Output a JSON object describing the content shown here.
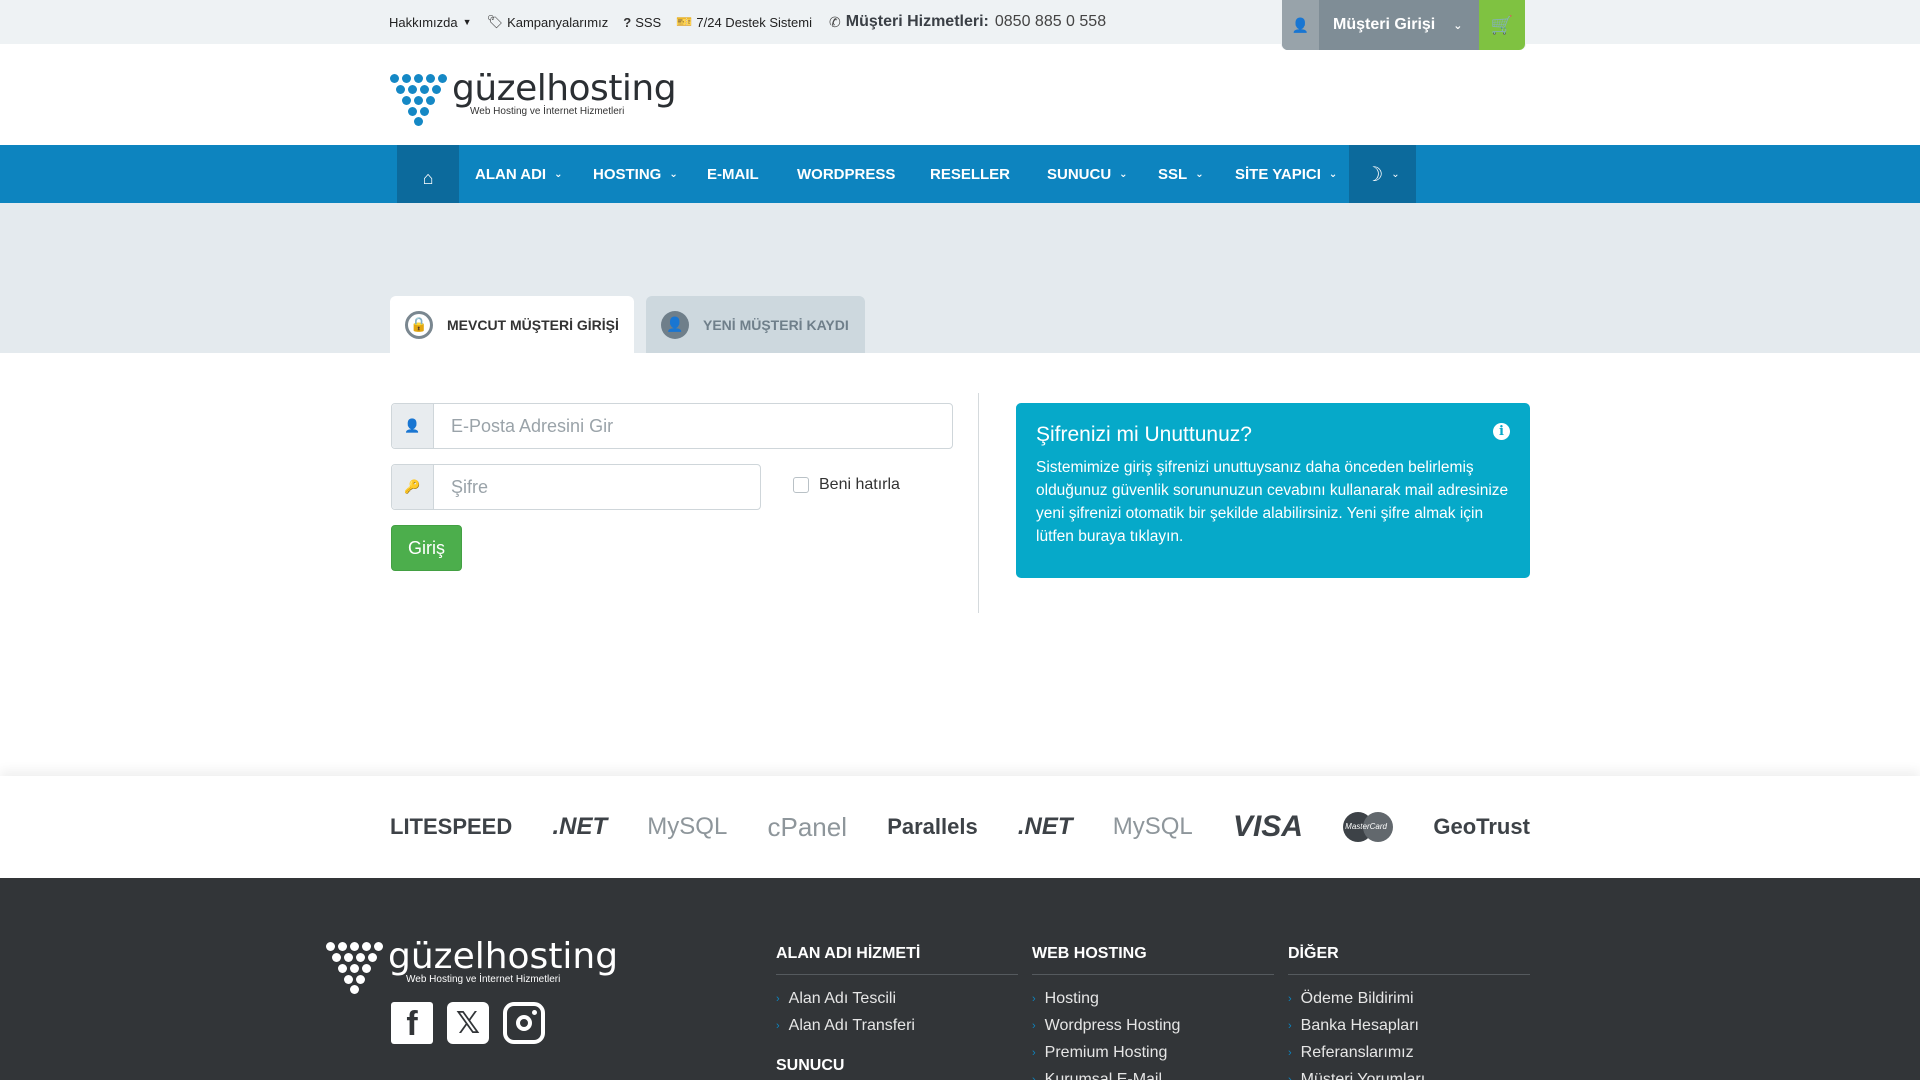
{
  "topbar": {
    "links": [
      {
        "label": "Hakkımızda",
        "icon": "none",
        "has_caret": true
      },
      {
        "label": "Kampanyalarımız",
        "icon": "tag-icon"
      },
      {
        "label": "SSS",
        "icon": "question-icon"
      },
      {
        "label": "7/24 Destek Sistemi",
        "icon": "ticket-icon"
      }
    ],
    "phone_label": "Müşteri Hizmetleri:",
    "phone_number": "0850 885 0 558",
    "login_label": "Müşteri Girişi"
  },
  "logo": {
    "name_part1": "güzel",
    "name_part2": "hosting",
    "tagline": "Web Hosting ve İnternet Hizmetleri"
  },
  "nav": {
    "items": [
      {
        "label": "ALAN ADI",
        "dropdown": true
      },
      {
        "label": "HOSTING",
        "dropdown": true
      },
      {
        "label": "E-MAIL",
        "dropdown": false
      },
      {
        "label": "WORDPRESS",
        "dropdown": false
      },
      {
        "label": "RESELLER",
        "dropdown": false
      },
      {
        "label": "SUNUCU",
        "dropdown": true
      },
      {
        "label": "SSL",
        "dropdown": true
      },
      {
        "label": "SİTE YAPICI",
        "dropdown": true
      }
    ]
  },
  "tabs": {
    "existing": "MEVCUT MÜŞTERİ GİRİŞİ",
    "new": "YENİ MÜŞTERİ KAYDI"
  },
  "form": {
    "email_placeholder": "E-Posta Adresini Gir",
    "password_placeholder": "Şifre",
    "remember_label": "Beni hatırla",
    "submit_label": "Giriş"
  },
  "info": {
    "title": "Şifrenizi mi Unuttunuz?",
    "text": "Sistemimize giriş şifrenizi unuttuysanız daha önceden belirlemiş olduğunuz güvenlik sorununuzun cevabını kullanarak mail adresinize yeni şifrenizi otomatik bir şekilde alabilirsiniz. Yeni şifre almak için lütfen buraya tıklayın."
  },
  "partners": [
    "LITESPEED",
    ".NET",
    "MySQL",
    "cPanel",
    "Parallels",
    ".NET",
    "MySQL",
    "VISA",
    "MasterCard",
    "GeoTrust"
  ],
  "footer": {
    "logo_name_part1": "güzel",
    "logo_name_part2": "hosting",
    "logo_tagline": "Web Hosting ve İnternet Hizmetleri",
    "col1": {
      "title": "ALAN ADI HİZMETİ",
      "items": [
        "Alan Adı Tescili",
        "Alan Adı Transferi"
      ],
      "title2": "SUNUCU"
    },
    "col2": {
      "title": "WEB HOSTING",
      "items": [
        "Hosting",
        "Wordpress Hosting",
        "Premium Hosting",
        "Kurumsal E-Mail"
      ]
    },
    "col3": {
      "title": "DİĞER",
      "items": [
        "Ödeme Bildirimi",
        "Banka Hesapları",
        "Referanslarımız",
        "Müşteri Yorumları"
      ]
    }
  },
  "colors": {
    "brand_blue": "#0d84bf",
    "nav_dark": "#0c6a9c",
    "green": "#4cae4c",
    "info": "#06a9c9",
    "footer": "#323538"
  }
}
